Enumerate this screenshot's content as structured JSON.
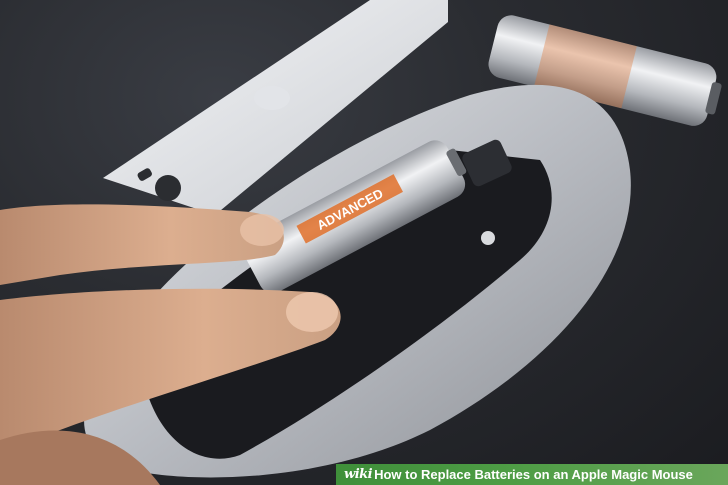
{
  "watermark": {
    "logo": "wiki",
    "title": "How to Replace Batteries on an Apple Magic Mouse"
  },
  "battery_label": "ADVANCED",
  "colors": {
    "caption_green": "#4e9d45",
    "mouse_silver": "#c9ccd1",
    "battery_orange": "#e0702a",
    "background_dark": "#24262b"
  }
}
